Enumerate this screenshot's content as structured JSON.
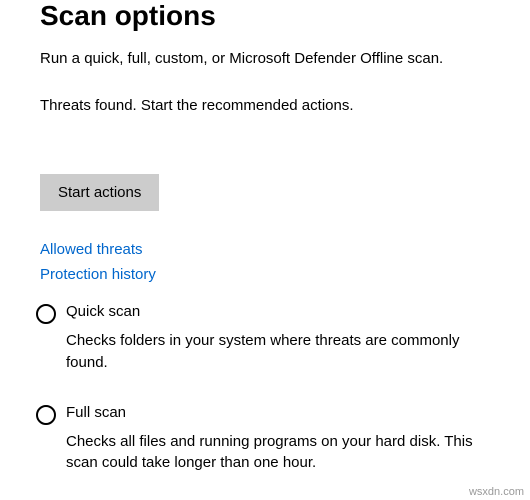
{
  "header": {
    "title": "Scan options",
    "subtitle": "Run a quick, full, custom, or Microsoft Defender Offline scan."
  },
  "status": {
    "message": "Threats found. Start the recommended actions."
  },
  "actions": {
    "start_button": "Start actions"
  },
  "links": {
    "allowed_threats": "Allowed threats",
    "protection_history": "Protection history"
  },
  "scan_options": [
    {
      "label": "Quick scan",
      "description": "Checks folders in your system where threats are commonly found."
    },
    {
      "label": "Full scan",
      "description": "Checks all files and running programs on your hard disk. This scan could take longer than one hour."
    }
  ],
  "watermark": "wsxdn.com"
}
